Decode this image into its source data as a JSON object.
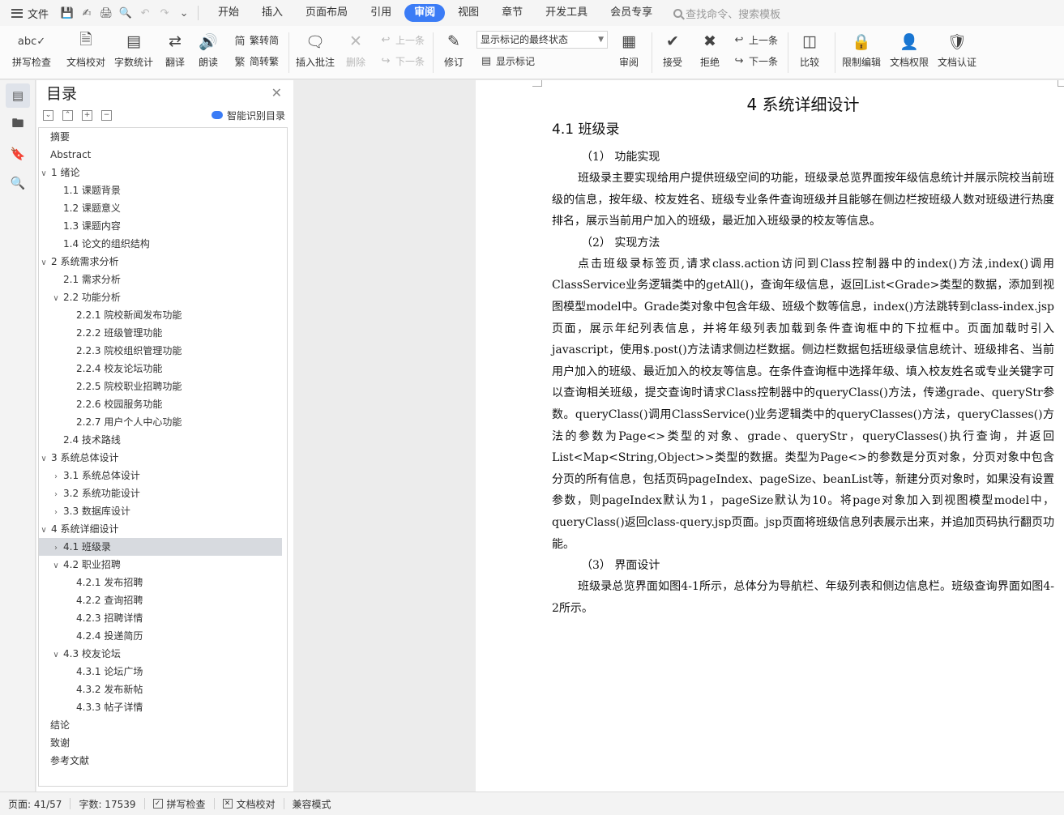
{
  "menubar": {
    "file_label": "文件",
    "tabs": [
      "开始",
      "插入",
      "页面布局",
      "引用",
      "审阅",
      "视图",
      "章节",
      "开发工具",
      "会员专享"
    ],
    "active_tab": "审阅",
    "search_placeholder": "查找命令、搜索模板"
  },
  "ribbon": {
    "spell_check": "拼写检查",
    "doc_proofread": "文档校对",
    "word_count": "字数统计",
    "translate": "翻译",
    "read_aloud": "朗读",
    "trad_to_simp": "繁转简",
    "simp_to_trad": "简转繁",
    "insert_comment": "插入批注",
    "delete": "删除",
    "prev_comment": "上一条",
    "next_comment": "下一条",
    "track_changes": "修订",
    "markup_state": "显示标记的最终状态",
    "show_markup": "显示标记",
    "review": "审阅",
    "accept": "接受",
    "reject": "拒绝",
    "prev_change": "上一条",
    "next_change": "下一条",
    "compare": "比较",
    "restrict_edit": "限制编辑",
    "doc_permission": "文档权限",
    "doc_certify": "文档认证"
  },
  "toc": {
    "title": "目录",
    "smart_label": "智能识别目录",
    "items": [
      {
        "text": "摘要",
        "level": 0,
        "arrow": ""
      },
      {
        "text": "Abstract",
        "level": 0,
        "arrow": ""
      },
      {
        "text": "1  绪论",
        "level": 0,
        "arrow": "v"
      },
      {
        "text": "1.1  课题背景",
        "level": 1,
        "arrow": ""
      },
      {
        "text": "1.2  课题意义",
        "level": 1,
        "arrow": ""
      },
      {
        "text": "1.3  课题内容",
        "level": 1,
        "arrow": ""
      },
      {
        "text": "1.4  论文的组织结构",
        "level": 1,
        "arrow": ""
      },
      {
        "text": "2  系统需求分析",
        "level": 0,
        "arrow": "v"
      },
      {
        "text": "2.1  需求分析",
        "level": 1,
        "arrow": ""
      },
      {
        "text": "2.2  功能分析",
        "level": 1,
        "arrow": "v"
      },
      {
        "text": "2.2.1  院校新闻发布功能",
        "level": 2,
        "arrow": ""
      },
      {
        "text": "2.2.2  班级管理功能",
        "level": 2,
        "arrow": ""
      },
      {
        "text": "2.2.3  院校组织管理功能",
        "level": 2,
        "arrow": ""
      },
      {
        "text": "2.2.4  校友论坛功能",
        "level": 2,
        "arrow": ""
      },
      {
        "text": "2.2.5  院校职业招聘功能",
        "level": 2,
        "arrow": ""
      },
      {
        "text": "2.2.6  校园服务功能",
        "level": 2,
        "arrow": ""
      },
      {
        "text": "2.2.7  用户个人中心功能",
        "level": 2,
        "arrow": ""
      },
      {
        "text": "2.4  技术路线",
        "level": 1,
        "arrow": ""
      },
      {
        "text": "3  系统总体设计",
        "level": 0,
        "arrow": "v"
      },
      {
        "text": "3.1  系统总体设计",
        "level": 1,
        "arrow": ">"
      },
      {
        "text": "3.2  系统功能设计",
        "level": 1,
        "arrow": ">"
      },
      {
        "text": "3.3  数据库设计",
        "level": 1,
        "arrow": ">"
      },
      {
        "text": "4  系统详细设计",
        "level": 0,
        "arrow": "v"
      },
      {
        "text": "4.1  班级录",
        "level": 1,
        "arrow": ">",
        "selected": true
      },
      {
        "text": "4.2  职业招聘",
        "level": 1,
        "arrow": "v"
      },
      {
        "text": "4.2.1  发布招聘",
        "level": 2,
        "arrow": ""
      },
      {
        "text": "4.2.2  查询招聘",
        "level": 2,
        "arrow": ""
      },
      {
        "text": "4.2.3  招聘详情",
        "level": 2,
        "arrow": ""
      },
      {
        "text": "4.2.4  投递简历",
        "level": 2,
        "arrow": ""
      },
      {
        "text": "4.3  校友论坛",
        "level": 1,
        "arrow": "v"
      },
      {
        "text": "4.3.1  论坛广场",
        "level": 2,
        "arrow": ""
      },
      {
        "text": "4.3.2  发布新帖",
        "level": 2,
        "arrow": ""
      },
      {
        "text": "4.3.3  帖子详情",
        "level": 2,
        "arrow": ""
      },
      {
        "text": "结论",
        "level": 0,
        "arrow": ""
      },
      {
        "text": "致谢",
        "level": 0,
        "arrow": ""
      },
      {
        "text": "参考文献",
        "level": 0,
        "arrow": ""
      }
    ]
  },
  "document": {
    "chapter_title": "4  系统详细设计",
    "section_title": "4.1  班级录",
    "sub1": "（1）  功能实现",
    "para1": "班级录主要实现给用户提供班级空间的功能，班级录总览界面按年级信息统计并展示院校当前班级的信息，按年级、校友姓名、班级专业条件查询班级并且能够在侧边栏按班级人数对班级进行热度排名，展示当前用户加入的班级，最近加入班级录的校友等信息。",
    "sub2": "（2）  实现方法",
    "para2": "点击班级录标签页,请求class.action访问到Class控制器中的index()方法,index()调用ClassService业务逻辑类中的getAll()，查询年级信息，返回List<Grade>类型的数据，添加到视图模型model中。Grade类对象中包含年级、班级个数等信息，index()方法跳转到class-index.jsp页面，展示年纪列表信息，并将年级列表加载到条件查询框中的下拉框中。页面加载时引入javascript，使用$.post()方法请求侧边栏数据。侧边栏数据包括班级录信息统计、班级排名、当前用户加入的班级、最近加入的校友等信息。在条件查询框中选择年级、填入校友姓名或专业关键字可以查询相关班级，提交查询时请求Class控制器中的queryClass()方法，传递grade、queryStr参数。queryClass()调用ClassService()业务逻辑类中的queryClasses()方法，queryClasses()方法的参数为Page<>类型的对象、grade、queryStr，queryClasses()执行查询，并返回List<Map<String,Object>>类型的数据。类型为Page<>的参数是分页对象，分页对象中包含分页的所有信息，包括页码pageIndex、pageSize、beanList等，新建分页对象时，如果没有设置参数，则pageIndex默认为1，pageSize默认为10。将page对象加入到视图模型model中，queryClass()返回class-query.jsp页面。jsp页面将班级信息列表展示出来，并追加页码执行翻页功能。",
    "sub3": "（3）  界面设计",
    "para3": "班级录总览界面如图4-1所示，总体分为导航栏、年级列表和侧边信息栏。班级查询界面如图4-2所示。"
  },
  "status": {
    "page": "页面: 41/57",
    "words": "字数: 17539",
    "spell_check": "拼写检查",
    "doc_proofread": "文档校对",
    "compat_mode": "兼容模式"
  }
}
